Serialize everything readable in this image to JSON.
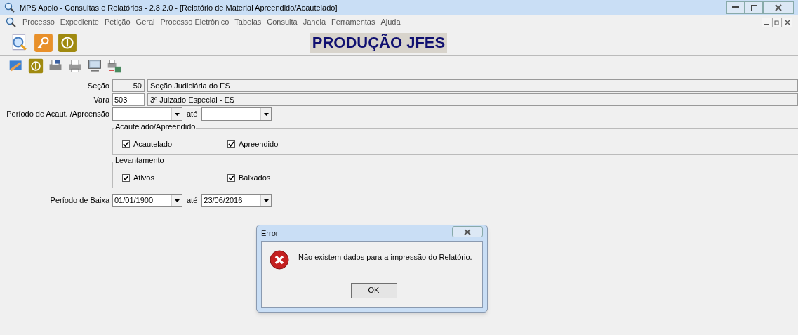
{
  "window": {
    "title": "MPS Apolo - Consultas e Relatórios - 2.8.2.0 - [Relatório de Material Apreendido/Acautelado]"
  },
  "menu": [
    "Processo",
    "Expediente",
    "Petição",
    "Geral",
    "Processo Eletrônico",
    "Tabelas",
    "Consulta",
    "Janela",
    "Ferramentas",
    "Ajuda"
  ],
  "banner": "PRODUÇÃO JFES",
  "form": {
    "secao": {
      "label": "Seção",
      "code": "50",
      "name": "Seção Judiciária do ES"
    },
    "vara": {
      "label": "Vara",
      "code": "503",
      "name": "3º Juizado Especial - ES"
    },
    "periodo_acaut": {
      "label": "Período de Acaut. /Apreensão",
      "to_label": "até"
    },
    "groups": [
      {
        "title": "Acautelado/Apreendido",
        "options": [
          {
            "label": "Acautelado",
            "checked": true
          },
          {
            "label": "Apreendido",
            "checked": true
          }
        ]
      },
      {
        "title": "Levantamento",
        "options": [
          {
            "label": "Ativos",
            "checked": true
          },
          {
            "label": "Baixados",
            "checked": true
          }
        ]
      }
    ],
    "periodo_baixa": {
      "label": "Período de Baixa",
      "from": "01/01/1900",
      "to_label": "até",
      "to": "23/06/2016"
    }
  },
  "dialog": {
    "title": "Error",
    "message": "Não existem dados para a impressão do Relatório.",
    "button": "OK"
  }
}
